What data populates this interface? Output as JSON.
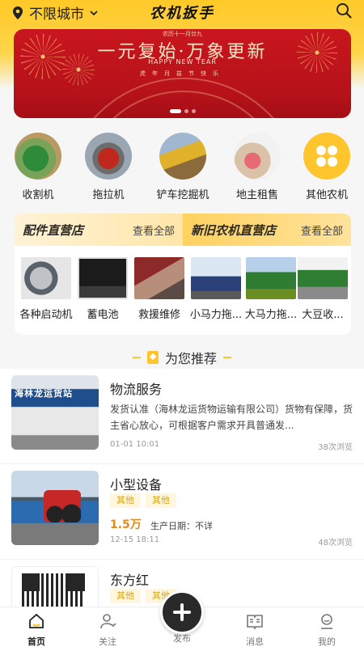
{
  "header": {
    "location": "不限城市",
    "logo": "农机扳手"
  },
  "banner": {
    "small_text": "农历十一月廿九",
    "main_text": "一元复始·万象更新",
    "sub_text": "HAPPY NEW TEAR",
    "sub_text2": "虎年月兹节快乐"
  },
  "categories": [
    {
      "label": "收割机",
      "icon": "harvester-icon"
    },
    {
      "label": "拖拉机",
      "icon": "tractor-icon"
    },
    {
      "label": "铲车挖掘机",
      "icon": "excavator-icon"
    },
    {
      "label": "地主租售",
      "icon": "landlord-icon"
    },
    {
      "label": "其他农机",
      "icon": "more-icon"
    }
  ],
  "stores": {
    "parts": {
      "title": "配件直营店",
      "more": "查看全部"
    },
    "used": {
      "title": "新旧农机直营店",
      "more": "查看全部"
    },
    "products": [
      {
        "label": "各种启动机"
      },
      {
        "label": "蓄电池"
      },
      {
        "label": "救援维修"
      },
      {
        "label": "小马力拖..."
      },
      {
        "label": "大马力拖..."
      },
      {
        "label": "大豆收..."
      }
    ]
  },
  "recommend": {
    "title": "为您推荐"
  },
  "listings": [
    {
      "title": "物流服务",
      "thumb_text": "海林龙运货站",
      "desc": "发货认准（海林龙运货物运输有限公司）货物有保障，货主省心放心，可根据客户需求开具普通发...",
      "time": "01-01 10:01",
      "views": "38次浏览"
    },
    {
      "title": "小型设备",
      "tags": [
        "其他",
        "其他"
      ],
      "price": "1.5万",
      "prod_date": "生产日期：不详",
      "time": "12-15 18:11",
      "views": "48次浏览"
    },
    {
      "title": "东方红",
      "tags": [
        "其他",
        "其他"
      ]
    }
  ],
  "nav": {
    "home": "首页",
    "follow": "关注",
    "publish": "发布",
    "messages": "消息",
    "mine": "我的"
  },
  "colors": {
    "accent": "#ffc52c",
    "price": "#e58a16",
    "tag_text": "#d7a41c"
  }
}
